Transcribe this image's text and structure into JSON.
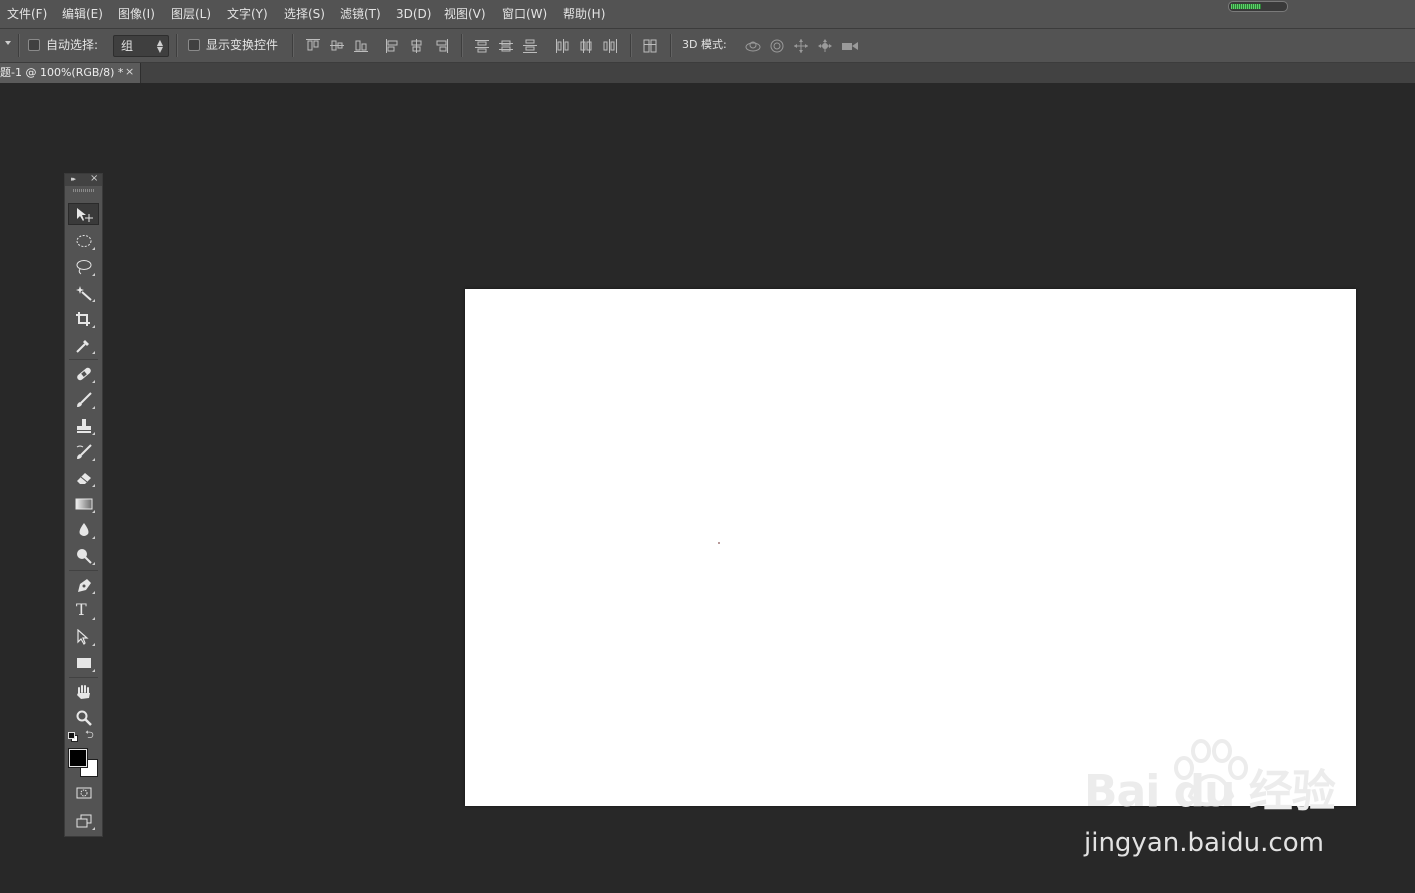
{
  "menubar": {
    "items": [
      "文件(F)",
      "编辑(E)",
      "图像(I)",
      "图层(L)",
      "文字(Y)",
      "选择(S)",
      "滤镜(T)",
      "3D(D)",
      "视图(V)",
      "窗口(W)",
      "帮助(H)"
    ],
    "progress_fraction": 0.55
  },
  "options": {
    "auto_select_label": "自动选择:",
    "auto_select_value": "组",
    "show_transform_label": "显示变换控件",
    "mode_3d_label": "3D 模式:",
    "align_icons": [
      "align-top-edges-icon",
      "align-vertical-centers-icon",
      "align-bottom-edges-icon",
      "align-left-edges-icon",
      "align-horizontal-centers-icon",
      "align-right-edges-icon"
    ],
    "distribute_icons": [
      "distribute-top-icon",
      "distribute-vcenter-icon",
      "distribute-bottom-icon",
      "distribute-left-icon",
      "distribute-hcenter-icon",
      "distribute-right-icon"
    ],
    "mode3d_icons": [
      "rotate-3d-icon",
      "roll-3d-icon",
      "drag-3d-icon",
      "slide-3d-icon",
      "scale-3d-icon"
    ]
  },
  "document_tab": {
    "title": "题-1 @ 100%(RGB/8) *",
    "close_glyph": "×"
  },
  "toolbox": {
    "collapse_glyph": "▸▸",
    "close_glyph": "×",
    "tools": [
      "move-tool-icon",
      "elliptical-marquee-tool-icon",
      "lasso-tool-icon",
      "magic-wand-tool-icon",
      "crop-tool-icon",
      "eyedropper-tool-icon",
      "healing-brush-tool-icon",
      "brush-tool-icon",
      "clone-stamp-tool-icon",
      "history-brush-tool-icon",
      "eraser-tool-icon",
      "gradient-tool-icon",
      "blur-tool-icon",
      "dodge-tool-icon",
      "pen-tool-icon",
      "type-tool-icon",
      "path-selection-tool-icon",
      "rectangle-tool-icon",
      "hand-tool-icon",
      "zoom-tool-icon"
    ],
    "text_tool_glyph": "T",
    "foreground_color": "#000000",
    "background_color": "#ffffff"
  },
  "watermark": {
    "brand": "Bai du 经验",
    "url": "jingyan.baidu.com"
  }
}
